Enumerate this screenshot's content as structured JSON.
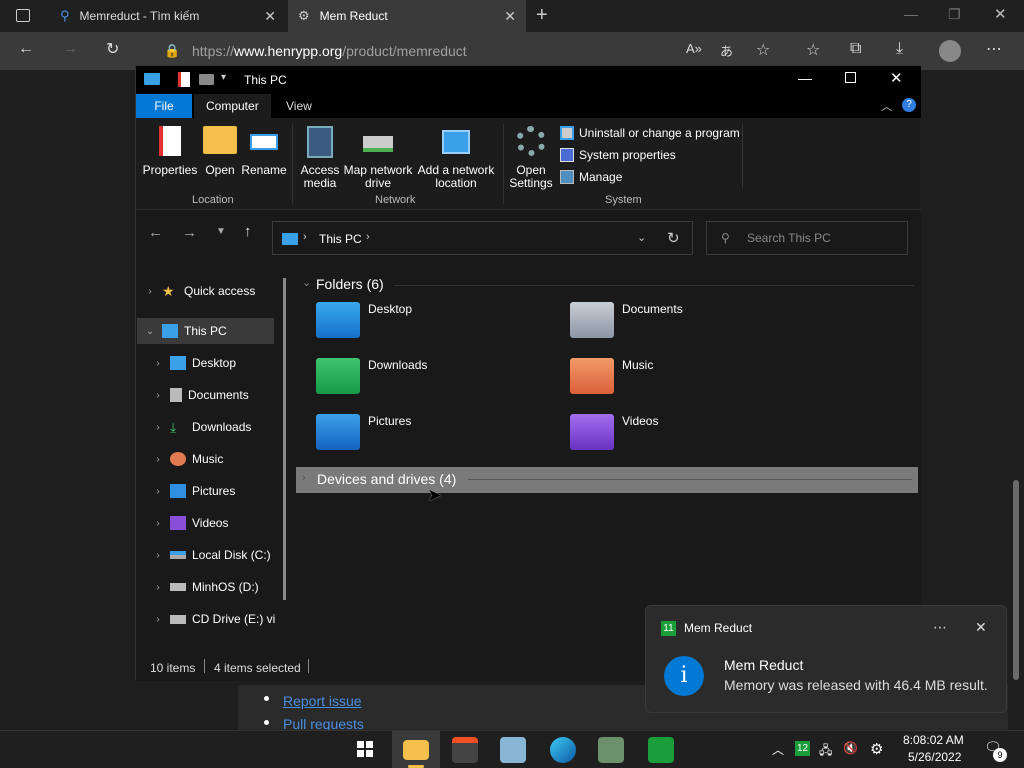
{
  "browser": {
    "tabs": [
      {
        "title": "Memreduct - Tìm kiếm"
      },
      {
        "title": "Mem Reduct"
      }
    ],
    "url_prefix": "https://",
    "url_domain": "www.henrypp.org",
    "url_path": "/product/memreduct",
    "page_links": [
      "Report issue",
      "Pull requests"
    ]
  },
  "explorer": {
    "title": "This PC",
    "ribbon_tabs": [
      "File",
      "Computer",
      "View"
    ],
    "ribbon": {
      "location": {
        "label": "Location",
        "buttons": [
          "Properties",
          "Open",
          "Rename"
        ]
      },
      "network": {
        "label": "Network",
        "buttons": [
          "Access media",
          "Map network drive",
          "Add a network location"
        ]
      },
      "system": {
        "label": "System",
        "open_settings": "Open Settings",
        "small": [
          "Uninstall or change a program",
          "System properties",
          "Manage"
        ]
      }
    },
    "address": "This PC",
    "search_placeholder": "Search This PC",
    "nav": [
      {
        "label": "Quick access"
      },
      {
        "label": "This PC"
      },
      {
        "label": "Desktop"
      },
      {
        "label": "Documents"
      },
      {
        "label": "Downloads"
      },
      {
        "label": "Music"
      },
      {
        "label": "Pictures"
      },
      {
        "label": "Videos"
      },
      {
        "label": "Local Disk (C:)"
      },
      {
        "label": "MinhOS (D:)"
      },
      {
        "label": "CD Drive (E:) vi"
      }
    ],
    "folders_header": "Folders (6)",
    "folders": [
      "Desktop",
      "Documents",
      "Downloads",
      "Music",
      "Pictures",
      "Videos"
    ],
    "devices_header": "Devices and drives (4)",
    "status": {
      "items": "10 items",
      "selected": "4 items selected"
    }
  },
  "notification": {
    "app_badge": "11",
    "app_name": "Mem Reduct",
    "title": "Mem Reduct",
    "message": "Memory was released with 46.4 MB result."
  },
  "taskbar": {
    "time": "8:08:02 AM",
    "date": "5/26/2022",
    "tray_badge": "12",
    "notif_count": "9"
  },
  "colors": {
    "accent": "#0078d4",
    "folder": "#f5c04a"
  }
}
